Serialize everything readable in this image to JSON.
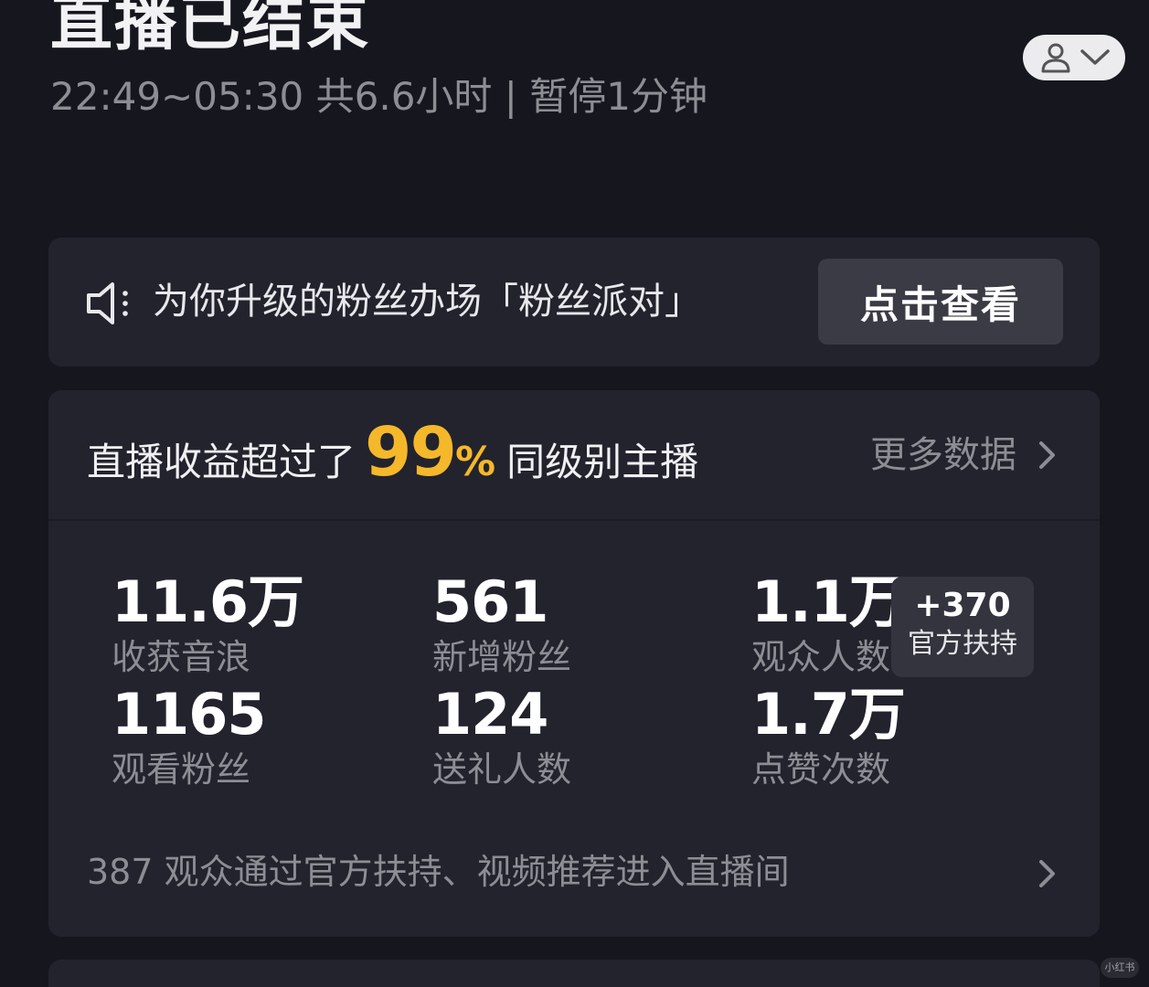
{
  "header": {
    "title": "直播已结束",
    "subtitle": "22:49~05:30 共6.6小时 | 暂停1分钟"
  },
  "icons": {
    "user": "user-icon",
    "dropdown": "chevron-down-icon",
    "speaker": "speaker-icon",
    "chevron": "chevron-right-icon"
  },
  "banner": {
    "text": "为你升级的粉丝办场「粉丝派对」",
    "button_label": "点击查看"
  },
  "summary": {
    "prefix": "直播收益超过了",
    "percent_value": "99",
    "percent_sign": "%",
    "suffix": "同级别主播",
    "more_link": "更多数据"
  },
  "stats": [
    {
      "value": "11.6万",
      "label": "收获音浪"
    },
    {
      "value": "561",
      "label": "新增粉丝"
    },
    {
      "value": "1.1万",
      "label": "观众人数"
    },
    {
      "value": "1165",
      "label": "观看粉丝"
    },
    {
      "value": "124",
      "label": "送礼人数"
    },
    {
      "value": "1.7万",
      "label": "点赞次数"
    }
  ],
  "boost": {
    "count": "+370",
    "label": "官方扶持"
  },
  "footer": {
    "text": "387 观众通过官方扶持、视频推荐进入直播间"
  },
  "watermark": {
    "text": "小红书"
  },
  "colors": {
    "background": "#16161e",
    "card": "#22232d",
    "accent": "#f5b82a",
    "muted_text": "#8d8d94"
  }
}
